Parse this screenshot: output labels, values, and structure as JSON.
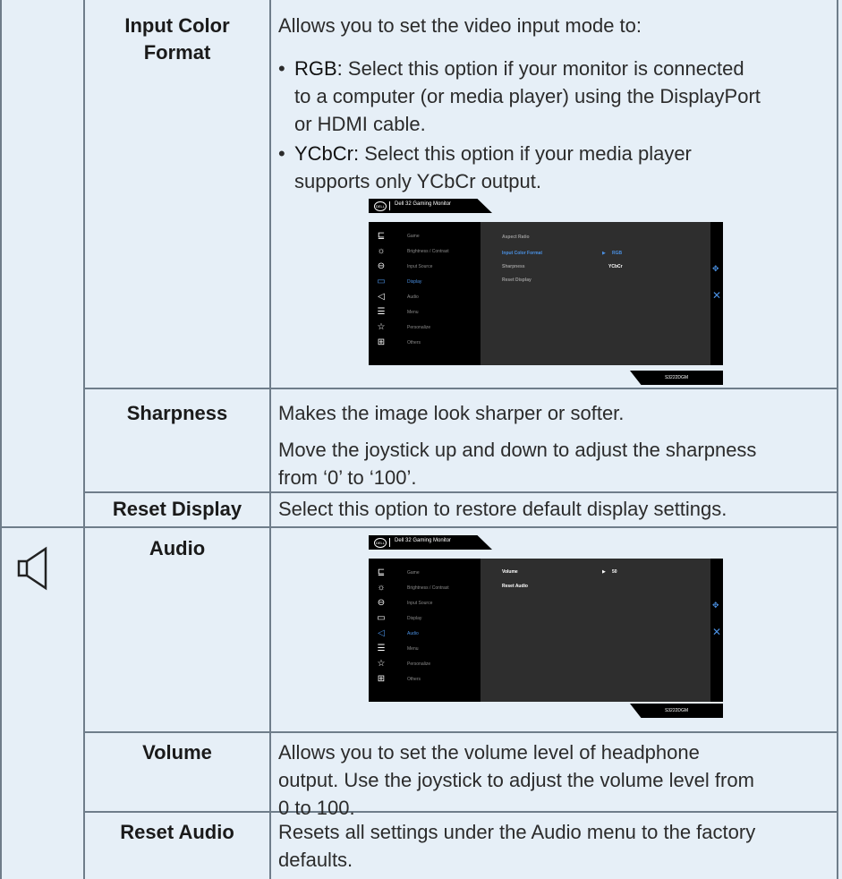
{
  "rows": {
    "input_color_format": {
      "label_line1": "Input Color",
      "label_line2": "Format",
      "intro": "Allows you to set the video input mode to:",
      "bullet_rgb_term": "RGB:",
      "bullet_rgb_l1": "Select this option if your monitor is connected",
      "bullet_rgb_l2": "to a computer (or media player) using the DisplayPort",
      "bullet_rgb_l3": "or HDMI cable.",
      "bullet_ycbcr_term": "YCbCr:",
      "bullet_ycbcr_l1": "Select this option if your media player",
      "bullet_ycbcr_l2": "supports only YCbCr output."
    },
    "sharpness": {
      "label": "Sharpness",
      "desc1": "Makes the image look sharper or softer.",
      "desc2_l1": "Move the joystick up and down to adjust the sharpness",
      "desc2_l2": "from ‘0’ to ‘100’."
    },
    "reset_display": {
      "label": "Reset Display",
      "desc": "Select this option to restore default display settings."
    },
    "audio": {
      "label": "Audio",
      "icon": "speaker-icon"
    },
    "volume": {
      "label": "Volume",
      "desc_l1": "Allows you to set the volume level of headphone",
      "desc_l2": "output. Use the joystick to adjust the volume level from",
      "desc_l3": "0 to 100."
    },
    "reset_audio": {
      "label": "Reset Audio",
      "desc_l1": "Resets all settings under the Audio menu to the factory",
      "desc_l2": "defaults."
    }
  },
  "osd": {
    "logo_text": "DELL",
    "title": "Dell 32 Gaming Monitor",
    "model": "S3222DGM",
    "menu": [
      "Game",
      "Brightness / Contrast",
      "Input Source",
      "Display",
      "Audio",
      "Menu",
      "Personalize",
      "Others"
    ],
    "menu_icons": [
      "game-icon",
      "brightness-icon",
      "input-source-icon",
      "display-icon",
      "audio-icon",
      "menu-icon",
      "personalize-icon",
      "others-icon"
    ],
    "display_options": [
      "Aspect Ratio",
      "Input Color Format",
      "Sharpness",
      "Reset Display"
    ],
    "display_values": [
      "RGB",
      "YCbCr"
    ],
    "audio_options": [
      "Volume",
      "Reset Audio"
    ],
    "audio_volume_value": "50",
    "active_color": "#4a90e2"
  }
}
